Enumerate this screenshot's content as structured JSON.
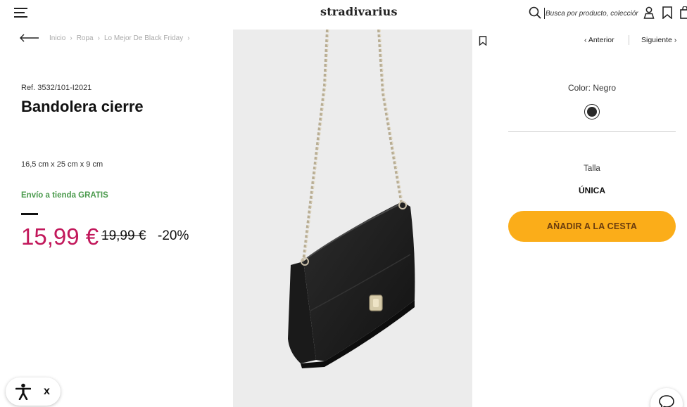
{
  "header": {
    "logo": "stradivarius",
    "search_placeholder": "Busca por producto, colección..."
  },
  "breadcrumb": [
    "Inicio",
    "Ropa",
    "Lo Mejor De Black Friday"
  ],
  "product": {
    "ref": "Ref. 3532/101-I2021",
    "title": "Bandolera cierre",
    "dimensions": "16,5 cm x 25 cm x 9 cm",
    "shipping": "Envío a tienda GRATIS",
    "price_current": "15,99 €",
    "price_old": "19,99 €",
    "discount": "-20%"
  },
  "nav": {
    "prev": "Anterior",
    "next": "Siguiente"
  },
  "options": {
    "color_label": "Color: Negro",
    "size_label": "Talla",
    "size_value": "ÚNICA",
    "add_to_cart": "AÑADIR A LA CESTA"
  },
  "accessibility": {
    "close": "x"
  },
  "colors": {
    "price": "#c2185b",
    "shipping": "#4a9a4c",
    "cta": "#fbad19",
    "cta_text": "#6a3c0e",
    "swatch": "#2a2a2a"
  },
  "icons": [
    "menu-icon",
    "search-icon",
    "user-icon",
    "wishlist-icon",
    "bag-icon",
    "back-arrow-icon",
    "bookmark-icon",
    "chevron-left-icon",
    "chevron-right-icon",
    "accessibility-icon",
    "chat-icon"
  ]
}
